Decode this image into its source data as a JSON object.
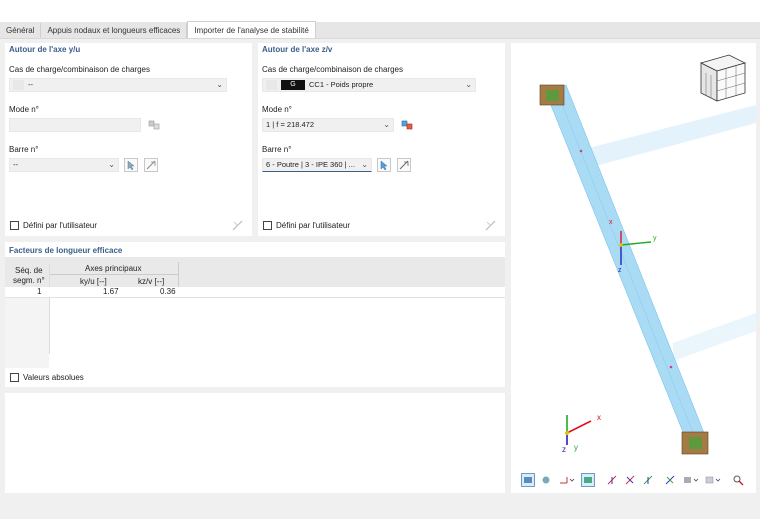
{
  "tabs": [
    "Général",
    "Appuis nodaux et longueurs efficaces",
    "Importer de l'analyse de stabilité"
  ],
  "left_group": {
    "title": "Autour de l'axe y/u",
    "load_label": "Cas de charge/combinaison de charges",
    "load_value": "--",
    "mode_label": "Mode n°",
    "mode_value": "",
    "member_label": "Barre n°",
    "member_value": "--",
    "user_defined": "Défini par l'utilisateur"
  },
  "right_group": {
    "title": "Autour de l'axe z/v",
    "load_label": "Cas de charge/combinaison de charges",
    "load_badge": "G",
    "load_value": "CC1 - Poids propre",
    "mode_label": "Mode n°",
    "mode_value": "1 | f = 218.472",
    "member_label": "Barre n°",
    "member_value": "6 - Poutre | 3 - IPE 360 | ...",
    "user_defined": "Défini par l'utilisateur"
  },
  "factors": {
    "title": "Facteurs de longueur efficace",
    "col_seg_1": "Séq. de",
    "col_seg_2": "segm. n°",
    "col_group": "Axes principaux",
    "col_ky": "ky/u [--]",
    "col_kz": "kz/v [--]",
    "rows": [
      {
        "seg": "1",
        "ky": "1.67",
        "kz": "0.36"
      }
    ],
    "absolute": "Valeurs absolues"
  },
  "viewport": {
    "axis_labels": {
      "x": "x",
      "y": "y",
      "z": "z"
    },
    "toolbar_icons": [
      "view-icon",
      "render-icon",
      "axis-icon",
      "display-icon",
      "xyz-icon",
      "x-view-icon",
      "y-view-icon",
      "z-view-icon",
      "iso-icon",
      "panel-icon",
      "reset-icon"
    ]
  },
  "colors": {
    "beam": "#a9dbf5",
    "beam_edge": "#7cc3ea",
    "support": "#8c6c3e",
    "accent": "#3a5f8a"
  }
}
